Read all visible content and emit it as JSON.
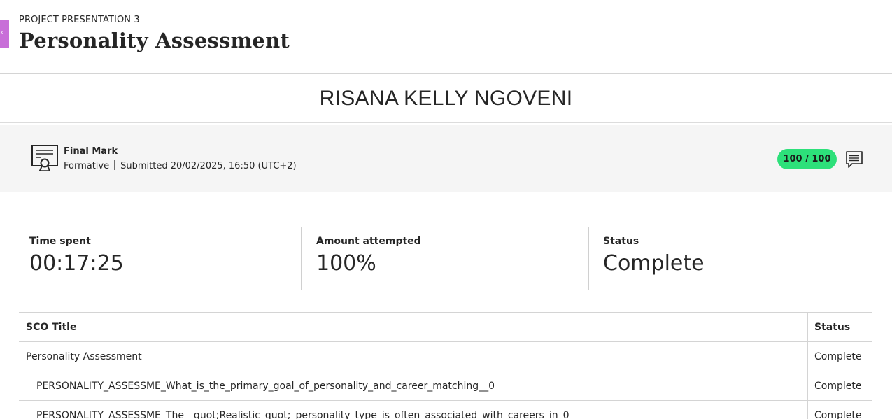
{
  "header": {
    "breadcrumb": "PROJECT PRESENTATION 3",
    "title": "Personality Assessment",
    "side_tab_glyph": "‹"
  },
  "student": {
    "name": "RISANA KELLY NGOVENI"
  },
  "grade": {
    "label": "Final Mark",
    "type": "Formative",
    "submitted": "Submitted 20/02/2025, 16:50 (UTC+2)",
    "score": "100 / 100",
    "score_color": "#2de07a",
    "icons": {
      "certificate": "certificate-icon",
      "feedback": "feedback-icon"
    }
  },
  "stats": [
    {
      "label": "Time spent",
      "value": "00:17:25"
    },
    {
      "label": "Amount attempted",
      "value": "100%"
    },
    {
      "label": "Status",
      "value": "Complete"
    }
  ],
  "table": {
    "columns": [
      "SCO Title",
      "Status"
    ],
    "rows": [
      {
        "title": "Personality Assessment",
        "status": "Complete"
      },
      {
        "title": "PERSONALITY_ASSESSME_What_is_the_primary_goal_of_personality_and_career_matching__0",
        "status": "Complete"
      },
      {
        "title": "PERSONALITY_ASSESSME_The__quot;Realistic_quot;_personality_type_is_often_associated_with_careers_in_0",
        "status": "Complete"
      }
    ]
  },
  "colors": {
    "accent_tab": "#c86ed8",
    "panel_bg": "#f5f5f5",
    "score_pill": "#2de07a"
  }
}
